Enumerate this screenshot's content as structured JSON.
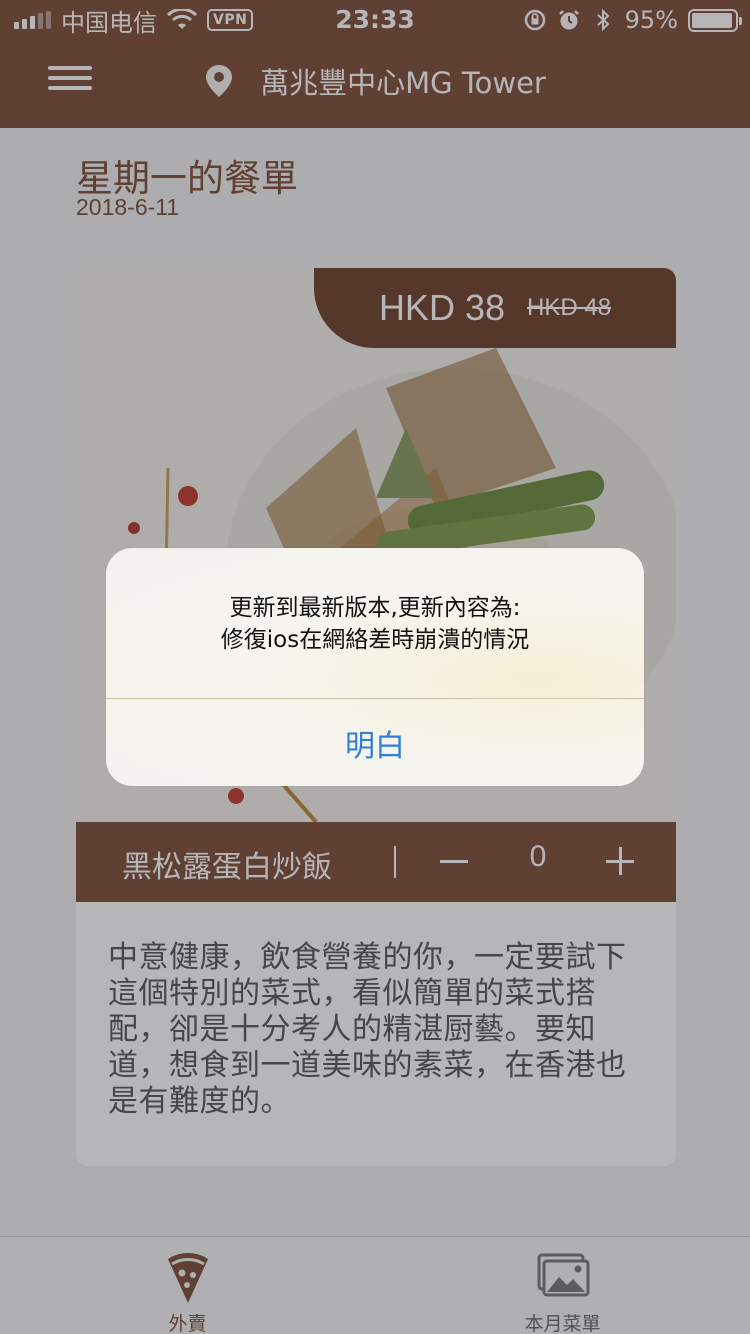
{
  "status_bar": {
    "carrier": "中国电信",
    "vpn": "VPN",
    "time": "23:33",
    "battery": "95%",
    "battery_level": 0.95,
    "icons": [
      "signal-icon",
      "wifi-icon",
      "rotation-lock-icon",
      "alarm-icon",
      "bluetooth-icon",
      "battery-icon"
    ]
  },
  "nav": {
    "location": "萬兆豐中心MG Tower",
    "icons": [
      "menu-icon",
      "location-pin-icon"
    ]
  },
  "page": {
    "title": "星期一的餐單",
    "date": "2018-6-11"
  },
  "dish": {
    "price": "HKD 38",
    "original_price": "HKD 48",
    "name": "黑松露蛋白炒飯",
    "quantity": "0",
    "description": "中意健康，飲食營養的你，一定要試下這個特別的菜式，看似簡單的菜式搭配，卻是十分考人的精湛厨藝。要知道，想食到一道美味的素菜，在香港也是有難度的。"
  },
  "tabs": [
    {
      "label": "外賣",
      "icon": "pizza-icon",
      "active": true
    },
    {
      "label": "本月菜單",
      "icon": "photos-icon",
      "active": false
    }
  ],
  "alert": {
    "line1": "更新到最新版本,更新內容為:",
    "line2": "修復ios在網絡差時崩潰的情況",
    "button": "明白"
  },
  "colors": {
    "brand": "#7d4c32",
    "price_tag": "#6e4128",
    "alert_button": "#2f7fd6"
  }
}
